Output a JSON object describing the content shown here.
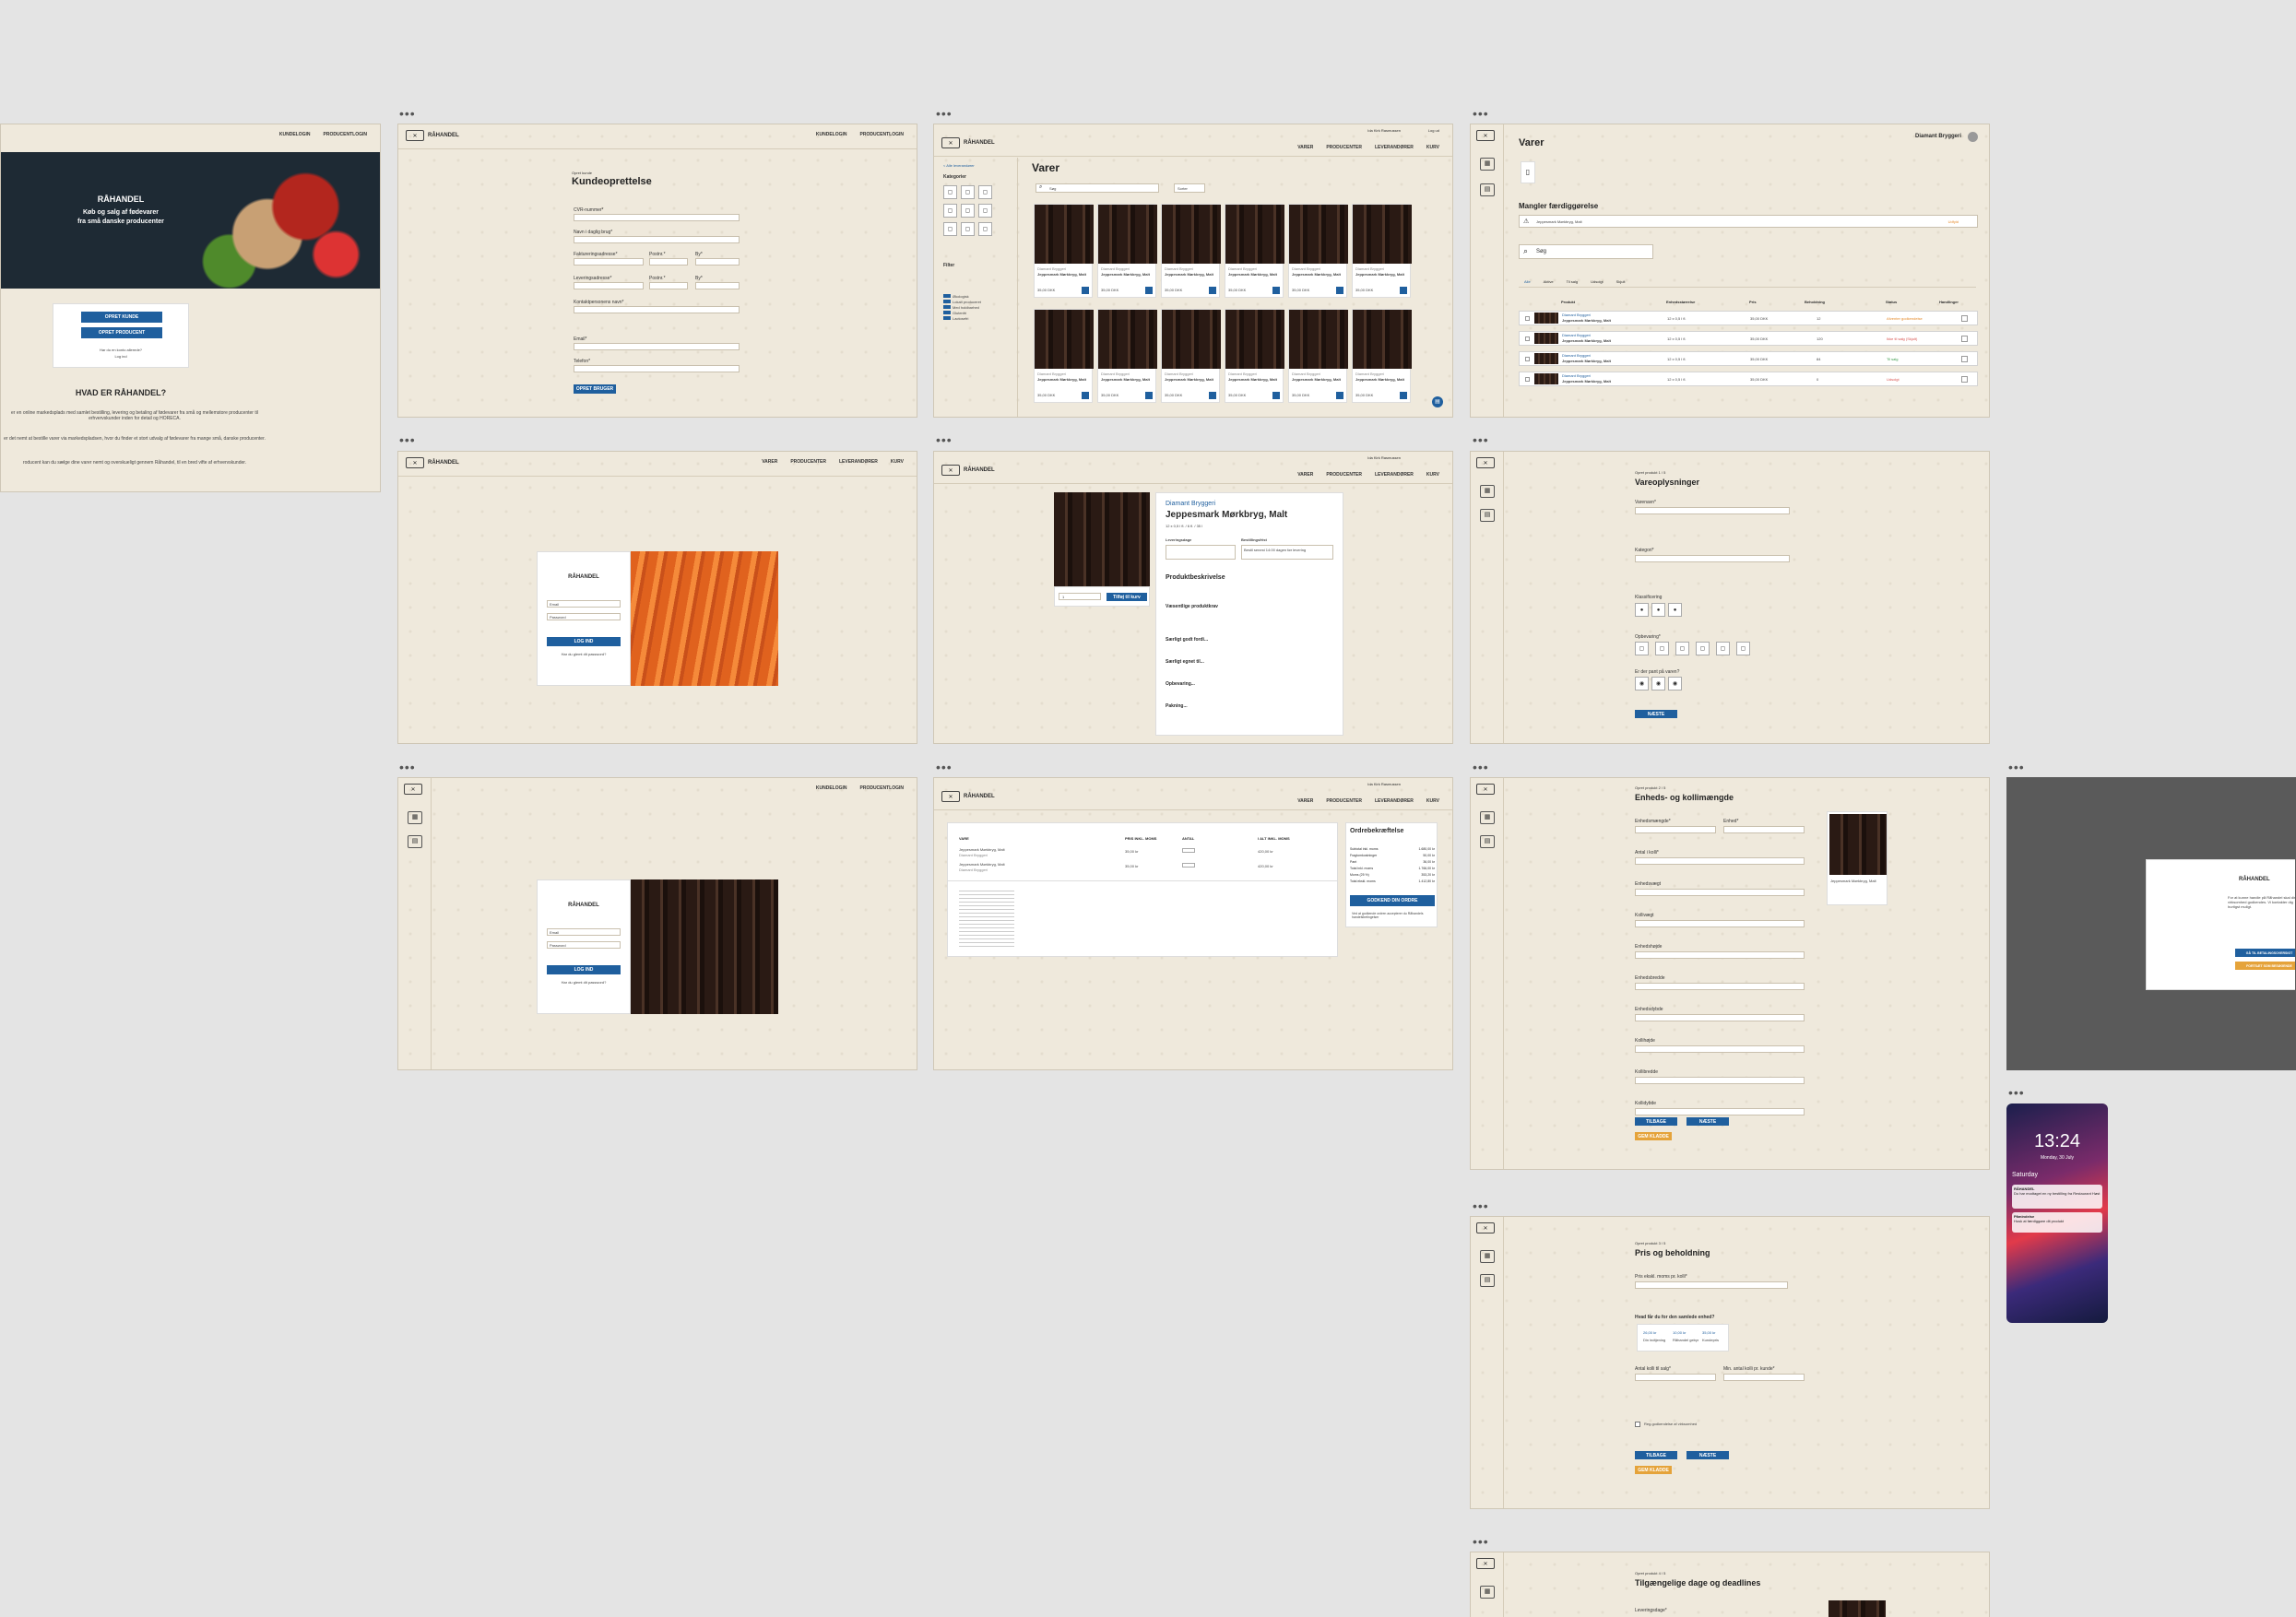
{
  "brand": "RÅHANDEL",
  "brand_tagline": "Råvarer fra producenter",
  "dots": "•••",
  "nav": {
    "kundelogin": "KUNDELOGIN",
    "producentlogin": "PRODUCENTLOGIN",
    "varer": "VARER",
    "producenter": "PRODUCENTER",
    "leverandoerer": "LEVERANDØRER",
    "kurv": "KURV",
    "user": "Ida Kirk Rasmussen",
    "logud": "Log ud"
  },
  "landing": {
    "hero_line1": "Køb og salg af fødevarer",
    "hero_line2": "fra små danske producenter",
    "btn_customer": "OPRET KUNDE",
    "btn_producer": "OPRET PRODUCENT",
    "login_hint1": "Har du en konto allerede?",
    "login_hint2": "Log ind",
    "section_title": "HVAD ER RÅHANDEL?",
    "para1": "er en online markedsplads med samlet bestilling, levering og betaling af fødevarer fra små og mellemstore producenter til erhvervskunder inden for detail og HORECA.",
    "para2": "er det nemt at bestille varer via markedspladsen, hvor du finder et stort udvalg af fødevarer fra mange små, danske producenter.",
    "para3": "roducent kan du sælge dine varer nemt og overskueligt gennem Råhandel, til en bred vifte af erhvervskunder."
  },
  "signup": {
    "small": "Opret kunde",
    "title": "Kundeoprettelse",
    "labels": [
      "CVR-nummer*",
      "Navn i daglig brug*",
      "Faktureringsadresse*",
      "Postnr.*",
      "By*",
      "Leveringsadresse*",
      "Postnr.*",
      "By*",
      "Kontaktpersonens navn*",
      "Email*",
      "Telefon*"
    ],
    "btn": "OPRET BRUGER"
  },
  "shop": {
    "breadcrumb": "< Alle leverandører",
    "title": "Varer",
    "categories": "Kategorier",
    "filter": "Filter",
    "search": "Søg",
    "sort": "Sorter",
    "product_name": "Jeppesmark Mørkbryg, Malt",
    "producer": "Diamant Bryggeri",
    "price": "35,00 DKK",
    "filters": [
      "Økologisk",
      "Lokalt produceret",
      "Med holdbarhed",
      "Glutenfri",
      "Lactosefri"
    ]
  },
  "list": {
    "title": "Varer",
    "company": "Diamant Bryggeri",
    "section": "Mangler færdiggørelse",
    "pending_name": "Jeppesmark Mørkbryg, Malt",
    "pending_link": "Udfyld",
    "search": "Søg",
    "tabs": [
      "Alle",
      "Aktive",
      "Til salg",
      "Udsolgt",
      "Skjult"
    ],
    "headers": [
      "Produkt",
      "Enhedsstørrelse",
      "Pris",
      "Beholdning",
      "Status",
      "Handlinger"
    ],
    "rows": [
      {
        "producer": "Diamant Bryggeri",
        "name": "Jeppesmark Mørkbryg, Malt",
        "size": "12 x 0,5 l fl.",
        "price": "35,00 DKK",
        "stock": "12",
        "status": "Afventer godkendelse",
        "color": "#e58a2a"
      },
      {
        "producer": "Diamant Bryggeri",
        "name": "Jeppesmark Mørkbryg, Malt",
        "size": "12 x 0,5 l fl.",
        "price": "35,00 DKK",
        "stock": "120",
        "status": "Ikke til salg (Skjult)",
        "color": "#d9534f"
      },
      {
        "producer": "Diamant Bryggeri",
        "name": "Jeppesmark Mørkbryg, Malt",
        "size": "12 x 0,5 l fl.",
        "price": "35,00 DKK",
        "stock": "84",
        "status": "Til salg",
        "color": "#3a9a4a"
      },
      {
        "producer": "Diamant Bryggeri",
        "name": "Jeppesmark Mørkbryg, Malt",
        "size": "12 x 0,5 l fl.",
        "price": "35,00 DKK",
        "stock": "0",
        "status": "Udsolgt",
        "color": "#d9534f"
      }
    ]
  },
  "login": {
    "field1": "Email",
    "field2": "Password",
    "btn": "LOG IND",
    "forgot": "Har du glemt dit password?"
  },
  "product": {
    "producer": "Diamant Bryggeri",
    "name": "Jeppesmark Mørkbryg, Malt",
    "size": "12 x 0,5 l fl. / 6 fl. / 35 l",
    "delivery": "Leveringsdage",
    "deadline": "Bestillingsfrist",
    "deadline_text": "Bestil senest 14:00 dagen før levering",
    "desc_title": "Produktbeskrivelse",
    "sections": [
      "Væsentlige produktkrav",
      "Særligt godt fordi...",
      "Særligt egnet til...",
      "Opbevaring...",
      "Pakning..."
    ],
    "buy": "Tilføj til kurv",
    "qty": "1"
  },
  "step1": {
    "small": "Opret produkt 1 / 5",
    "title": "Vareoplysninger",
    "labels": [
      "Varenavn*",
      "Kategori*",
      "Klassificering",
      "Opbevaring*",
      "Er der pant på varen?"
    ],
    "btn": "NÆSTE"
  },
  "cart": {
    "headers": [
      "VARE",
      "PRIS INKL. MOMS",
      "ANTAL",
      "I ALT INKL. MOMS"
    ],
    "items": [
      {
        "name": "Jeppesmark Mørkbryg, Malt",
        "sub": "Diamant Bryggeri",
        "price": "35,00 kr",
        "total": "420,00 kr"
      },
      {
        "name": "Jeppesmark Mørkbryg, Malt",
        "sub": "Diamant Bryggeri",
        "price": "35,00 kr",
        "total": "420,00 kr"
      }
    ],
    "summary_title": "Ordrebekræftelse",
    "summary_lines": [
      {
        "k": "Subtotal inkl. moms",
        "v": "1.680,00 kr"
      },
      {
        "k": "Fragtomkostninger",
        "v": "50,00 kr"
      },
      {
        "k": "Pant",
        "v": "36,00 kr"
      },
      {
        "k": "Total inkl. moms",
        "v": "1.766,00 kr"
      },
      {
        "k": "Moms (25 %)",
        "v": "353,20 kr"
      },
      {
        "k": "Total ekskl. moms",
        "v": "1.412,80 kr"
      }
    ],
    "btn": "GODKEND DIN ORDRE",
    "terms": "Ved at godkende ordren accepterer du Råhandels handelsbetingelser"
  },
  "step2": {
    "small": "Opret produkt 2 / 5",
    "title": "Enheds- og kollimængde",
    "labels": [
      "Enhedsmængde*",
      "Enhed*",
      "Antal i kolli*",
      "Enhedsvægt",
      "Kollivægt",
      "Enhedshøjde",
      "Enhedsbredde",
      "Enhedsdybde",
      "Kollihøjde",
      "Kollibredde",
      "Kollidybde"
    ],
    "btn_back": "TILBAGE",
    "btn_next": "NÆSTE",
    "btn_save": "GEM KLADDE"
  },
  "step3": {
    "small": "Opret produkt 3 / 5",
    "title": "Pris og beholdning",
    "price_label": "Pris ekskl. moms pr. kolli*",
    "price_hint": "Hvad får du for den samlede enhed?",
    "calc": [
      {
        "v": "26,00 kr",
        "k": "Din indtjening"
      },
      {
        "v": "10,00 kr",
        "k": "Råhandel gebyr"
      },
      {
        "v": "35,00 kr",
        "k": "Kundepris"
      }
    ],
    "lbl_a": "Antal kolli til salg*",
    "lbl_b": "Min. antal kolli pr. kunde*",
    "checkbox": "Reg.godkendelse af virksomhed",
    "btn_back": "TILBAGE",
    "btn_next": "NÆSTE",
    "btn_save": "GEM KLADDE"
  },
  "step4": {
    "small": "Opret produkt 4 / 5",
    "title": "Tilgængelige dage og deadlines",
    "label": "Leveringsdage*"
  },
  "modal": {
    "text": "For at kunne handle på Råhandel skal din virksomhed godkendes. Vi kontakter dig hurtigst muligt.",
    "btn1": "GÅ TIL BETALINGSOVERSIGT",
    "btn2": "FORTSÆT SOM BESØGENDE"
  },
  "phone": {
    "time": "13:24",
    "date": "Monday, 30 July",
    "day": "Saturday",
    "notif1_title": "RÅHANDEL",
    "notif1_text": "Du har modtaget en ny bestilling fra Restaurant Høst",
    "notif2_title": "Påmindelse",
    "notif2_text": "Husk at færdiggøre dit produkt"
  }
}
